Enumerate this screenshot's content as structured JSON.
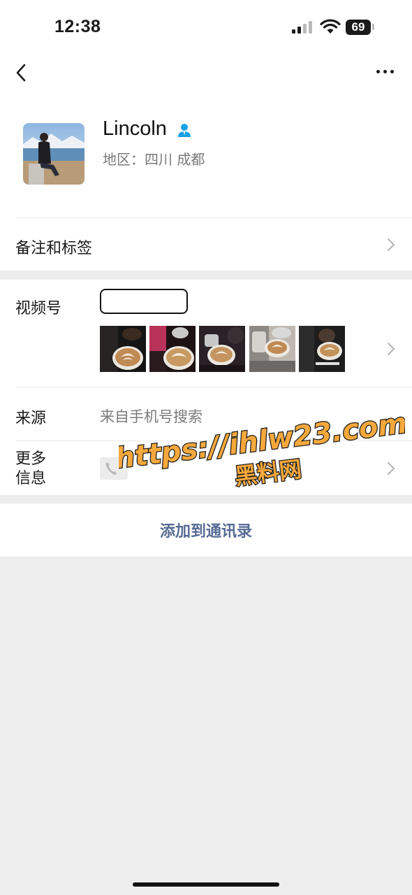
{
  "status_bar": {
    "time": "12:38",
    "battery": "69",
    "icons": [
      "signal-icon",
      "wifi-icon",
      "battery-icon"
    ]
  },
  "nav": {
    "icons": [
      "back-chevron-icon",
      "more-icon"
    ]
  },
  "profile": {
    "name": "Lincoln",
    "region": "地区：四川 成都",
    "badge_icon": "contact-person-icon",
    "badge_color": "#1aa1e6"
  },
  "rows": {
    "remarks_label": "备注和标签",
    "channels_label": "视频号",
    "source_label": "来源",
    "source_value": "来自手机号搜索",
    "more_info_label": "更多\n信息",
    "phone_icon": "phone-icon"
  },
  "actions": {
    "add_to_contacts": "添加到通讯录"
  },
  "watermark": {
    "line1": "https://ihlw23.com",
    "line2": "黑料网",
    "color": "#f5a83c"
  },
  "colors": {
    "link": "#576b95",
    "background": "#ededed",
    "secondary_text": "#7a7a7a"
  }
}
